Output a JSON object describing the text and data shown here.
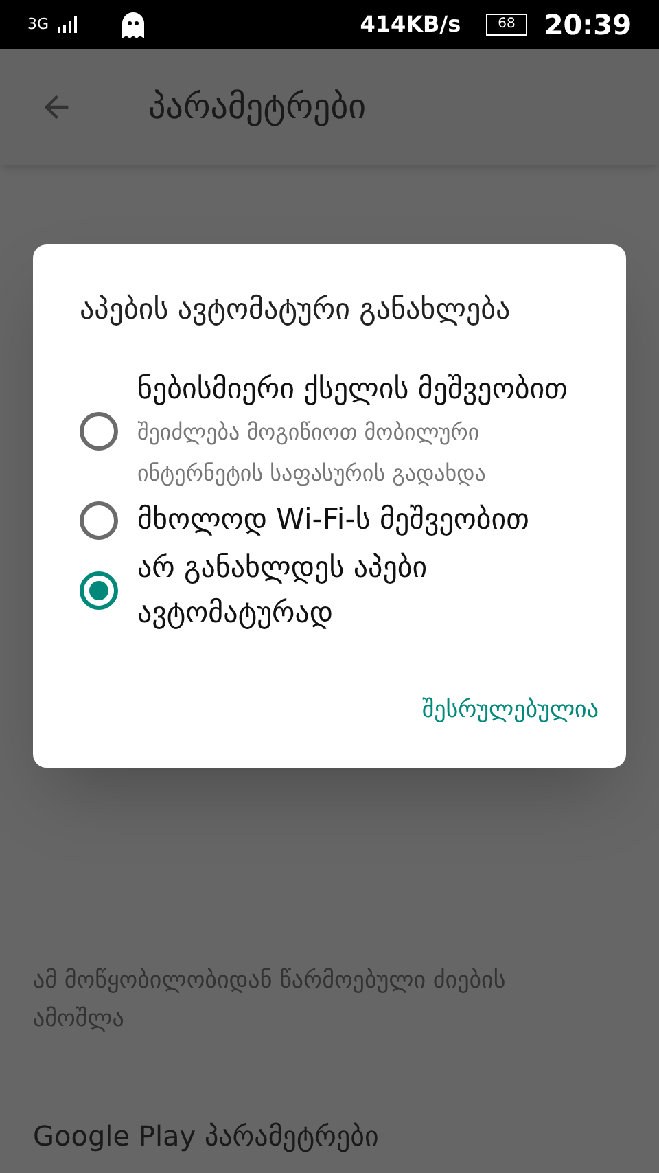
{
  "status_bar": {
    "network": "3G",
    "speed": "414KB/s",
    "battery": "68",
    "time": "20:39"
  },
  "toolbar": {
    "title": "პარამეტრები"
  },
  "settings": [
    {
      "kind": "description",
      "text": "ამ მოწყობილობიდან წარმოებული ძიების ამოშლა"
    },
    {
      "kind": "title",
      "text": "Google Play პარამეტრები"
    }
  ],
  "dialog": {
    "title": "აპების ავტომატური განახლება",
    "options": [
      {
        "label": "ნებისმიერი ქსელის მეშვეობით",
        "summary": "შეიძლება მოგიწიოთ მობილური ინტერნეტის საფასურის გადახდა",
        "selected": false
      },
      {
        "label": "მხოლოდ Wi-Fi-ს მეშვეობით",
        "selected": false
      },
      {
        "label": "არ განახლდეს აპები ავტომატურად",
        "selected": true
      }
    ],
    "button": "შესრულებულია"
  }
}
